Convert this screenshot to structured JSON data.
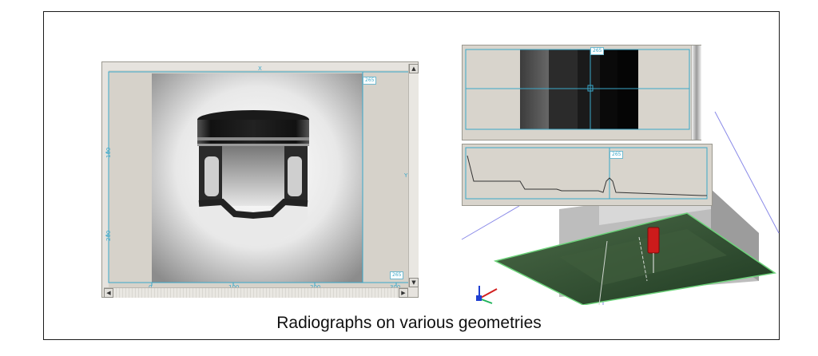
{
  "caption": "Radiographs on various geometries",
  "left_viewer": {
    "axis_x_label": "X",
    "axis_y_label": "Y",
    "tag_top": "265",
    "tag_bottom": "265",
    "x_ticks": [
      "0",
      "100",
      "200",
      "300"
    ],
    "y_ticks": [
      "100",
      "200"
    ]
  },
  "right_viewer": {
    "tag_image": "265",
    "tag_profile": "265"
  },
  "colors": {
    "cyan": "#3aa8c9",
    "panel_bg": "#d8d4cc",
    "plate_green": "#3b5a3a",
    "marker_red": "#cc1b1b"
  },
  "icons": [
    "scroll-arrow-up-icon",
    "scroll-arrow-down-icon",
    "scroll-arrow-left-icon",
    "scroll-arrow-right-icon",
    "xyz-axes-icon"
  ]
}
